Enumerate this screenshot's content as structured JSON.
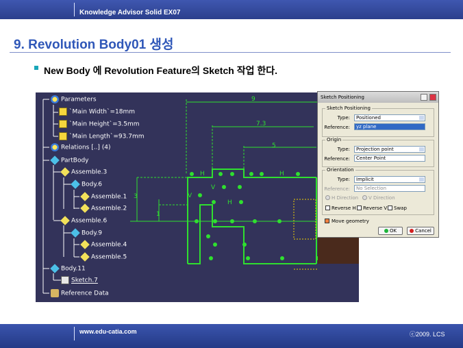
{
  "header": {
    "title": "Knowledge Advisor Solid  EX07"
  },
  "slide": {
    "title": "9. Revolution Body01 생성",
    "bullet": "New Body 에 Revolution Feature의 Sketch 작업 한다."
  },
  "tree": {
    "parameters": "Parameters",
    "main_width": "`Main Width`=18mm",
    "main_height": "`Main Height`=3.5mm",
    "main_length": "`Main Length`=93.7mm",
    "relations": "Relations [..] (4)",
    "partbody": "PartBody",
    "assembly3": "Assemble.3",
    "body6": "Body.6",
    "assembly1": "Assemble.1",
    "assembly2": "Assemble.2",
    "assembly6": "Assemble.6",
    "body9": "Body.9",
    "assembly4": "Assemble.4",
    "assembly5": "Assemble.5",
    "body11": "Body.11",
    "sketch7": "Sketch.7",
    "reference": "Reference Data"
  },
  "sketch": {
    "dim_9": "9",
    "dim_73": "7.3",
    "dim_5": "5",
    "dim_3": "3",
    "dim_1": "1",
    "constraint_h": "H",
    "constraint_v": "V"
  },
  "dialog": {
    "title": "Sketch Positioning",
    "group_sketch": "Sketch Positioning",
    "type_label": "Type:",
    "type_value": "Positioned",
    "reference_label": "Reference:",
    "reference_value": "yz plane",
    "group_origin": "Origin",
    "origin_type_value": "Projection point",
    "origin_reference_value": "Center Point",
    "group_orientation": "Orientation",
    "orient_type_value": "Implicit",
    "orient_reference_value": "No Selection",
    "h_direction": "H Direction",
    "v_direction": "V Direction",
    "reverse_h": "Reverse H",
    "reverse_v": "Reverse V",
    "swap": "Swap",
    "move_geometry": "Move geometry",
    "ok": "OK",
    "cancel": "Cancel"
  },
  "footer": {
    "url": "www.edu-catia.com",
    "copyright": "ⓒ2009. LCS"
  },
  "colors": {
    "banner": "#2b3f8c",
    "title": "#2f57b8",
    "sketch_green": "#2fe02f",
    "tree_bg": "#33335a"
  }
}
